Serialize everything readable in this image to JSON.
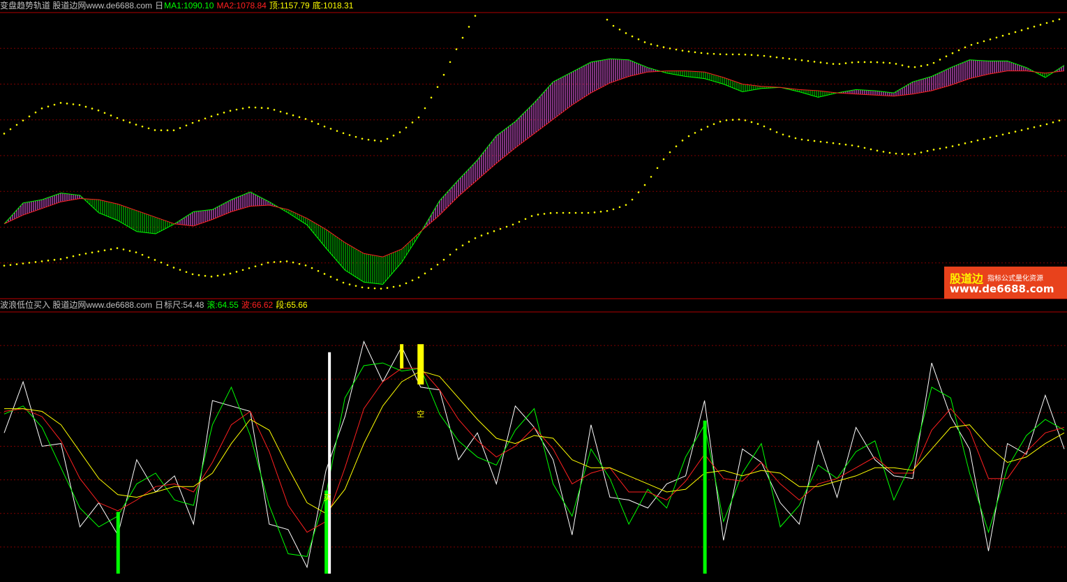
{
  "top_panel": {
    "name": "变盘趋势轨道 股道边网www.de6688.com",
    "icon": "日",
    "ma1": "MA1:1090.10",
    "ma2": "MA2:1078.84",
    "top": "顶:1157.79",
    "bottom": "底:1018.31",
    "colors": {
      "ma1": "#00ff00",
      "ma2": "#ff2020",
      "top": "#ffff00",
      "bottom": "#ffff00",
      "name": "#c0c0c0"
    }
  },
  "bottom_panel": {
    "name": "波浪低位买入 股道边网www.de6688.com",
    "icon": "日",
    "ruler": "标尺:54.48",
    "gun": "滚:64.55",
    "bo": "波:66.62",
    "duan": "段:65.66",
    "colors": {
      "gun": "#00ff00",
      "bo": "#ff2020",
      "duan": "#ffff00",
      "name": "#c0c0c0"
    },
    "signal_labels": [
      "买",
      "空"
    ]
  },
  "watermark": {
    "brand": "股道边",
    "tagline": "指标公式量化资源",
    "url": "www.de6688.com"
  },
  "chart_data": [
    {
      "type": "line",
      "title": "变盘趋势轨道",
      "series": [
        {
          "name": "MA1",
          "values": [
            1008,
            1027,
            1030,
            1036,
            1034,
            1018,
            1011,
            1001,
            999,
            1008,
            1019,
            1021,
            1030,
            1037,
            1028,
            1018,
            1007,
            986,
            966,
            955,
            953,
            973,
            1000,
            1029,
            1048,
            1066,
            1088,
            1101,
            1118,
            1137,
            1146,
            1155,
            1158,
            1157,
            1150,
            1145,
            1142,
            1140,
            1135,
            1128,
            1131,
            1132,
            1128,
            1123,
            1127,
            1130,
            1129,
            1127,
            1137,
            1142,
            1150,
            1157,
            1156,
            1156,
            1150,
            1141,
            1152
          ]
        },
        {
          "name": "MA2",
          "values": [
            1008,
            1016,
            1022,
            1028,
            1031,
            1030,
            1026,
            1020,
            1014,
            1008,
            1006,
            1012,
            1019,
            1024,
            1025,
            1021,
            1013,
            1003,
            991,
            981,
            978,
            985,
            1001,
            1016,
            1033,
            1048,
            1063,
            1077,
            1090,
            1103,
            1116,
            1127,
            1136,
            1142,
            1146,
            1147,
            1147,
            1146,
            1141,
            1135,
            1133,
            1132,
            1130,
            1129,
            1127,
            1126,
            1125,
            1124,
            1126,
            1129,
            1134,
            1140,
            1144,
            1147,
            1147,
            1145,
            1147
          ]
        },
        {
          "name": "顶",
          "values": [
            1090,
            1102,
            1113,
            1118,
            1116,
            1111,
            1104,
            1098,
            1093,
            1093,
            1100,
            1106,
            1111,
            1114,
            1113,
            1108,
            1103,
            1096,
            1090,
            1085,
            1083,
            1092,
            1106,
            1135,
            1170,
            1200,
            1225,
            1240,
            1250,
            1250,
            1240,
            1218,
            1190,
            1180,
            1172,
            1168,
            1165,
            1163,
            1162,
            1162,
            1161,
            1159,
            1157,
            1155,
            1153,
            1155,
            1155,
            1154,
            1150,
            1153,
            1162,
            1170,
            1175,
            1180,
            1185,
            1190,
            1195
          ]
        },
        {
          "name": "底",
          "values": [
            970,
            972,
            974,
            976,
            980,
            983,
            986,
            982,
            975,
            968,
            962,
            960,
            963,
            968,
            973,
            974,
            970,
            962,
            954,
            950,
            949,
            952,
            960,
            972,
            986,
            996,
            1002,
            1008,
            1016,
            1018,
            1018,
            1018,
            1020,
            1026,
            1046,
            1070,
            1086,
            1095,
            1102,
            1103,
            1098,
            1090,
            1085,
            1083,
            1081,
            1079,
            1075,
            1072,
            1071,
            1075,
            1078,
            1082,
            1086,
            1090,
            1094,
            1098,
            1103
          ]
        }
      ],
      "ylim": [
        940,
        1200
      ],
      "grid": true
    },
    {
      "type": "line",
      "title": "波浪低位买入",
      "series": [
        {
          "name": "滚",
          "values": [
            62,
            65,
            57,
            42,
            27,
            20,
            24,
            36,
            40,
            30,
            28,
            58,
            72,
            54,
            28,
            10,
            9,
            32,
            68,
            80,
            81,
            78,
            79,
            62,
            52,
            46,
            43,
            56,
            64,
            36,
            24,
            49,
            38,
            21,
            34,
            27,
            46,
            58,
            22,
            40,
            51,
            20,
            28,
            43,
            38,
            48,
            52,
            30,
            45,
            72,
            68,
            40,
            18,
            42,
            54,
            60,
            56
          ]
        },
        {
          "name": "波",
          "values": [
            63,
            64,
            61,
            52,
            38,
            29,
            26,
            30,
            35,
            36,
            33,
            44,
            58,
            63,
            48,
            28,
            18,
            22,
            42,
            64,
            74,
            79,
            79,
            71,
            60,
            52,
            46,
            50,
            57,
            49,
            36,
            40,
            42,
            33,
            33,
            30,
            37,
            47,
            38,
            37,
            44,
            36,
            30,
            36,
            38,
            42,
            46,
            40,
            40,
            56,
            64,
            56,
            38,
            38,
            48,
            55,
            57
          ]
        },
        {
          "name": "段",
          "values": [
            64,
            64,
            63,
            58,
            48,
            38,
            32,
            31,
            33,
            35,
            35,
            40,
            51,
            60,
            56,
            42,
            29,
            25,
            34,
            51,
            65,
            74,
            78,
            76,
            68,
            60,
            53,
            51,
            54,
            53,
            45,
            42,
            42,
            39,
            36,
            33,
            34,
            40,
            41,
            39,
            41,
            40,
            35,
            35,
            37,
            39,
            42,
            42,
            41,
            49,
            57,
            58,
            50,
            44,
            46,
            51,
            55
          ]
        }
      ],
      "ylim": [
        0,
        100
      ],
      "signals": [
        {
          "type": "buy",
          "index": 6
        },
        {
          "type": "buy",
          "index": 17
        },
        {
          "type": "sell",
          "index": 21
        },
        {
          "type": "sell",
          "index": 22
        },
        {
          "type": "buy",
          "index": 37
        }
      ],
      "grid": true
    }
  ]
}
